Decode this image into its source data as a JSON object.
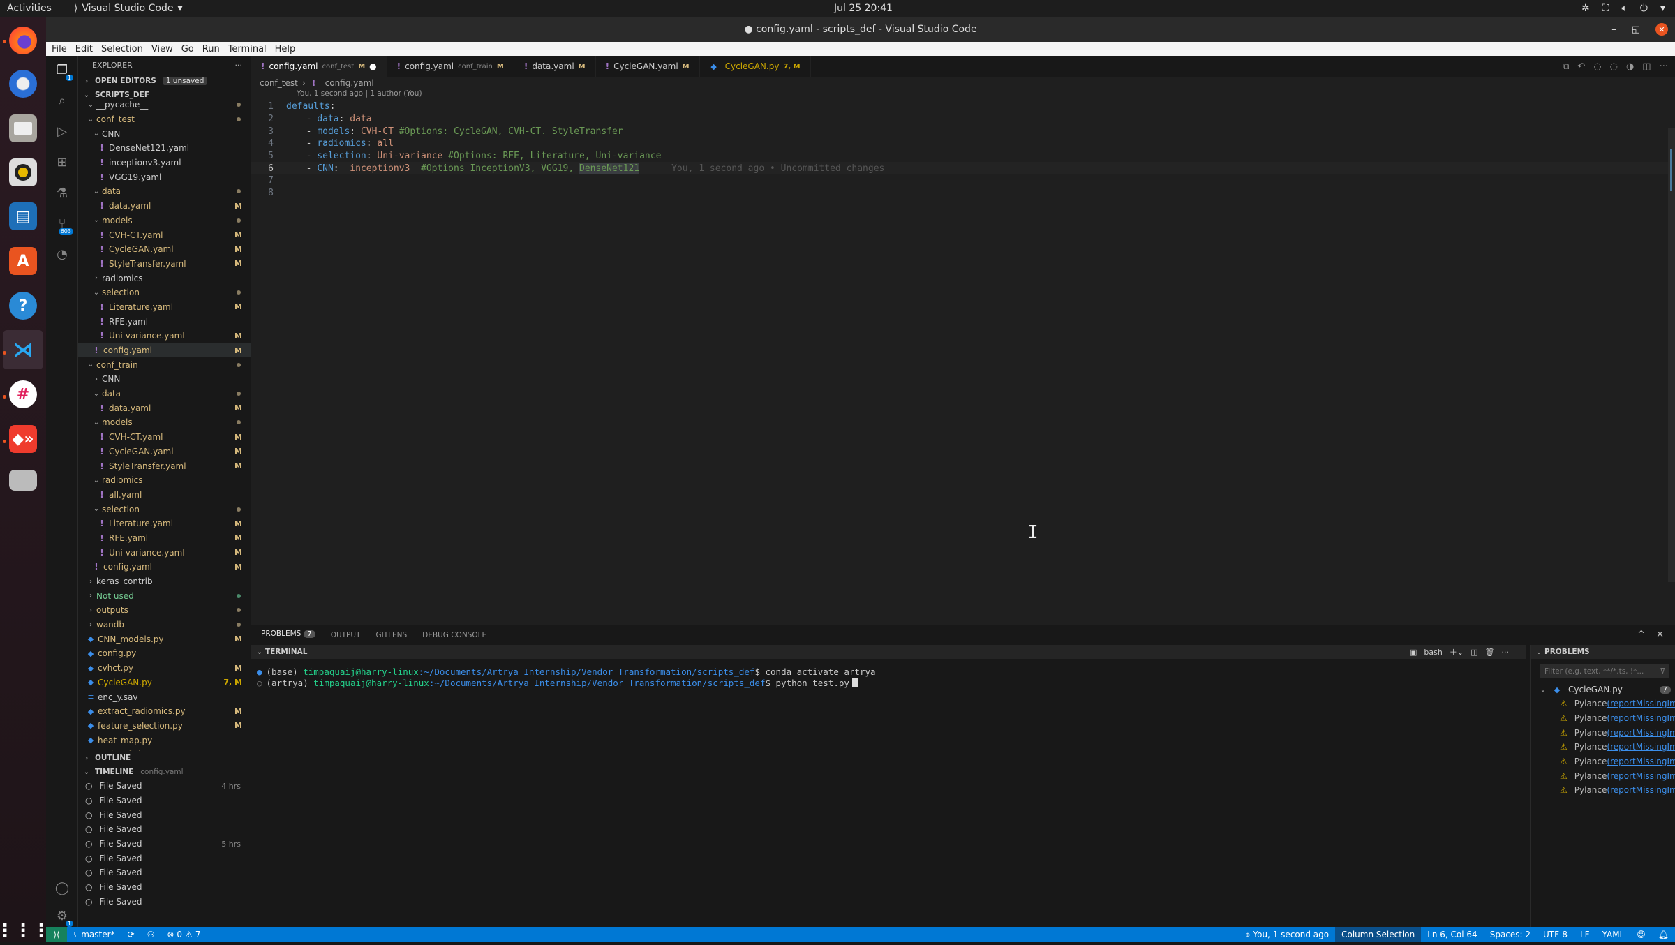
{
  "os": {
    "activities": "Activities",
    "app_name": "Visual Studio Code",
    "clock": "Jul 25  20:41",
    "dock": [
      "firefox-icon",
      "thunderbird-icon",
      "files-icon",
      "rhythmbox-icon",
      "writer-icon",
      "software-center-icon",
      "help-icon",
      "vscode-icon",
      "slack-icon",
      "anydesk-icon",
      "drive-icon",
      "show-apps-icon"
    ]
  },
  "window": {
    "title": "● config.yaml - scripts_def - Visual Studio Code",
    "menu": [
      "File",
      "Edit",
      "Selection",
      "View",
      "Go",
      "Run",
      "Terminal",
      "Help"
    ]
  },
  "activity_bar": {
    "explorer_badge": "1",
    "scm_badge": "603",
    "settings_badge": "1"
  },
  "sidebar": {
    "title": "EXPLORER",
    "open_editors": "OPEN EDITORS",
    "open_editors_badge": "1 unsaved",
    "root": "SCRIPTS_DEF",
    "tree": [
      {
        "label": "__pycache__",
        "depth": 1,
        "kind": "folder",
        "open": true,
        "status": "dot",
        "color": "plain"
      },
      {
        "label": "conf_test",
        "depth": 1,
        "kind": "folder",
        "open": true,
        "status": "dot"
      },
      {
        "label": "CNN",
        "depth": 2,
        "kind": "folder",
        "open": true,
        "status": "",
        "color": "plain"
      },
      {
        "label": "DenseNet121.yaml",
        "depth": 3,
        "kind": "yaml",
        "status": "",
        "color": "plain"
      },
      {
        "label": "inceptionv3.yaml",
        "depth": 3,
        "kind": "yaml",
        "status": "",
        "color": "plain"
      },
      {
        "label": "VGG19.yaml",
        "depth": 3,
        "kind": "yaml",
        "status": "",
        "color": "plain"
      },
      {
        "label": "data",
        "depth": 2,
        "kind": "folder",
        "open": true,
        "status": "dot"
      },
      {
        "label": "data.yaml",
        "depth": 3,
        "kind": "yaml",
        "status": "M"
      },
      {
        "label": "models",
        "depth": 2,
        "kind": "folder",
        "open": true,
        "status": "dot"
      },
      {
        "label": "CVH-CT.yaml",
        "depth": 3,
        "kind": "yaml",
        "status": "M"
      },
      {
        "label": "CycleGAN.yaml",
        "depth": 3,
        "kind": "yaml",
        "status": "M"
      },
      {
        "label": "StyleTransfer.yaml",
        "depth": 3,
        "kind": "yaml",
        "status": "M"
      },
      {
        "label": "radiomics",
        "depth": 2,
        "kind": "folder",
        "open": false,
        "status": "",
        "color": "plain"
      },
      {
        "label": "selection",
        "depth": 2,
        "kind": "folder",
        "open": true,
        "status": "dot"
      },
      {
        "label": "Literature.yaml",
        "depth": 3,
        "kind": "yaml",
        "status": "M"
      },
      {
        "label": "RFE.yaml",
        "depth": 3,
        "kind": "yaml",
        "status": "",
        "color": "plain"
      },
      {
        "label": "Uni-variance.yaml",
        "depth": 3,
        "kind": "yaml",
        "status": "M"
      },
      {
        "label": "config.yaml",
        "depth": 2,
        "kind": "yaml",
        "status": "M",
        "selected": true
      },
      {
        "label": "conf_train",
        "depth": 1,
        "kind": "folder",
        "open": true,
        "status": "dot"
      },
      {
        "label": "CNN",
        "depth": 2,
        "kind": "folder",
        "open": false,
        "status": "",
        "color": "plain"
      },
      {
        "label": "data",
        "depth": 2,
        "kind": "folder",
        "open": true,
        "status": "dot"
      },
      {
        "label": "data.yaml",
        "depth": 3,
        "kind": "yaml",
        "status": "M"
      },
      {
        "label": "models",
        "depth": 2,
        "kind": "folder",
        "open": true,
        "status": "dot"
      },
      {
        "label": "CVH-CT.yaml",
        "depth": 3,
        "kind": "yaml",
        "status": "M"
      },
      {
        "label": "CycleGAN.yaml",
        "depth": 3,
        "kind": "yaml",
        "status": "M"
      },
      {
        "label": "StyleTransfer.yaml",
        "depth": 3,
        "kind": "yaml",
        "status": "M"
      },
      {
        "label": "radiomics",
        "depth": 2,
        "kind": "folder",
        "open": true,
        "status": ""
      },
      {
        "label": "all.yaml",
        "depth": 3,
        "kind": "yaml",
        "status": ""
      },
      {
        "label": "selection",
        "depth": 2,
        "kind": "folder",
        "open": true,
        "status": "dot"
      },
      {
        "label": "Literature.yaml",
        "depth": 3,
        "kind": "yaml",
        "status": "M"
      },
      {
        "label": "RFE.yaml",
        "depth": 3,
        "kind": "yaml",
        "status": "M"
      },
      {
        "label": "Uni-variance.yaml",
        "depth": 3,
        "kind": "yaml",
        "status": "M"
      },
      {
        "label": "config.yaml",
        "depth": 2,
        "kind": "yaml",
        "status": "M"
      },
      {
        "label": "keras_contrib",
        "depth": 1,
        "kind": "folder",
        "open": false,
        "status": "",
        "color": "plain"
      },
      {
        "label": "Not used",
        "depth": 1,
        "kind": "folder",
        "open": false,
        "status": "gdot",
        "color": "green"
      },
      {
        "label": "outputs",
        "depth": 1,
        "kind": "folder",
        "open": false,
        "status": "dot"
      },
      {
        "label": "wandb",
        "depth": 1,
        "kind": "folder",
        "open": false,
        "status": "dot"
      },
      {
        "label": "CNN_models.py",
        "depth": 1,
        "kind": "py",
        "status": "M"
      },
      {
        "label": "config.py",
        "depth": 1,
        "kind": "py",
        "status": ""
      },
      {
        "label": "cvhct.py",
        "depth": 1,
        "kind": "py",
        "status": "M"
      },
      {
        "label": "CycleGAN.py",
        "depth": 1,
        "kind": "py",
        "status": "7, M",
        "color": "yellow"
      },
      {
        "label": "enc_y.sav",
        "depth": 1,
        "kind": "file",
        "status": "",
        "color": "plain"
      },
      {
        "label": "extract_radiomics.py",
        "depth": 1,
        "kind": "py",
        "status": "M"
      },
      {
        "label": "feature_selection.py",
        "depth": 1,
        "kind": "py",
        "status": "M"
      },
      {
        "label": "heat_map.py",
        "depth": 1,
        "kind": "py",
        "status": ""
      },
      {
        "label": "make_tf_datasets.py",
        "depth": 1,
        "kind": "py",
        "status": ""
      }
    ],
    "outline": "OUTLINE",
    "timeline": "TIMELINE",
    "timeline_file": "config.yaml",
    "timeline_items": [
      {
        "label": "File Saved",
        "time": "4 hrs"
      },
      {
        "label": "File Saved",
        "time": ""
      },
      {
        "label": "File Saved",
        "time": ""
      },
      {
        "label": "File Saved",
        "time": ""
      },
      {
        "label": "File Saved",
        "time": "5 hrs"
      },
      {
        "label": "File Saved",
        "time": ""
      },
      {
        "label": "File Saved",
        "time": ""
      },
      {
        "label": "File Saved",
        "time": ""
      },
      {
        "label": "File Saved",
        "time": ""
      }
    ]
  },
  "tabs": [
    {
      "name": "config.yaml",
      "desc": "conf_test",
      "status": "M",
      "dirty": true,
      "icon": "yaml",
      "active": true
    },
    {
      "name": "config.yaml",
      "desc": "conf_train",
      "status": "M",
      "icon": "yaml"
    },
    {
      "name": "data.yaml",
      "desc": "",
      "status": "M",
      "icon": "yaml"
    },
    {
      "name": "CycleGAN.yaml",
      "desc": "",
      "status": "M",
      "icon": "yaml"
    },
    {
      "name": "CycleGAN.py",
      "desc": "",
      "status": "7, M",
      "icon": "py",
      "warn": true
    }
  ],
  "breadcrumb": {
    "folder": "conf_test",
    "file": "config.yaml"
  },
  "blame_header": "You, 1 second ago | 1 author (You)",
  "code": [
    {
      "n": "1",
      "tokens": [
        [
          "k",
          "defaults"
        ],
        [
          "p",
          ":"
        ]
      ]
    },
    {
      "n": "2",
      "tokens": [
        [
          "p",
          "  - "
        ],
        [
          "k",
          "data"
        ],
        [
          "p",
          ": "
        ],
        [
          "v",
          "data"
        ]
      ]
    },
    {
      "n": "3",
      "tokens": [
        [
          "p",
          "  - "
        ],
        [
          "k",
          "models"
        ],
        [
          "p",
          ": "
        ],
        [
          "v",
          "CVH-CT "
        ],
        [
          "c",
          "#Options: CycleGAN, CVH-CT. StyleTransfer"
        ]
      ]
    },
    {
      "n": "4",
      "tokens": [
        [
          "p",
          "  - "
        ],
        [
          "k",
          "radiomics"
        ],
        [
          "p",
          ": "
        ],
        [
          "v",
          "all"
        ]
      ]
    },
    {
      "n": "5",
      "tokens": [
        [
          "p",
          "  - "
        ],
        [
          "k",
          "selection"
        ],
        [
          "p",
          ": "
        ],
        [
          "v",
          "Uni-variance "
        ],
        [
          "c",
          "#Options: RFE, Literature, Uni-variance"
        ]
      ]
    },
    {
      "n": "6",
      "tokens": [
        [
          "p",
          "  - "
        ],
        [
          "k",
          "CNN"
        ],
        [
          "p",
          ":  "
        ],
        [
          "v",
          "inceptionv3  "
        ],
        [
          "c",
          "#Options InceptionV3, VGG19, "
        ],
        [
          "hl",
          "DenseNet121"
        ]
      ],
      "current": true,
      "ghost": "You, 1 second ago • Uncommitted changes"
    },
    {
      "n": "7",
      "tokens": []
    },
    {
      "n": "8",
      "tokens": []
    }
  ],
  "panel": {
    "tabs": [
      {
        "label": "PROBLEMS",
        "count": "7",
        "active": true
      },
      {
        "label": "OUTPUT"
      },
      {
        "label": "GITLENS"
      },
      {
        "label": "DEBUG CONSOLE"
      }
    ],
    "terminal_title": "TERMINAL",
    "shell": "bash",
    "terminal_lines": [
      {
        "env": "(base) ",
        "user": "timpaquaij@harry-linux",
        "path": ":~/Documents/Artrya Internship/Vendor Transformation/scripts_def",
        "cmd": "$ conda activate artrya",
        "dot": "blue"
      },
      {
        "env": "(artrya) ",
        "user": "timpaquaij@harry-linux",
        "path": ":~/Documents/Artrya Internship/Vendor Transformation/scripts_def",
        "cmd": "$ python test.py",
        "dot": "grey",
        "caret": true
      }
    ],
    "problems_title": "PROBLEMS",
    "filter_placeholder": "Filter (e.g. text, **/*.ts, !*...",
    "problem_file": "CycleGAN.py",
    "problem_count": "7",
    "problems": [
      {
        "source": "Pylance",
        "code": "(reportMissingImports)"
      },
      {
        "source": "Pylance",
        "code": "(reportMissingImports)"
      },
      {
        "source": "Pylance",
        "code": "(reportMissingImports)"
      },
      {
        "source": "Pylance",
        "code": "(reportMissingImports)"
      },
      {
        "source": "Pylance",
        "code": "(reportMissingImports)"
      },
      {
        "source": "Pylance",
        "code": "(reportMissingImports)"
      },
      {
        "source": "Pylance",
        "code": "(reportMissingImports)"
      }
    ]
  },
  "statusbar": {
    "branch": "master*",
    "errors": "0",
    "warnings": "7",
    "blame": "You, 1 second ago",
    "column_selection": "Column Selection",
    "position": "Ln 6, Col 64",
    "spaces": "Spaces: 2",
    "encoding": "UTF-8",
    "eol": "LF",
    "language": "YAML"
  }
}
